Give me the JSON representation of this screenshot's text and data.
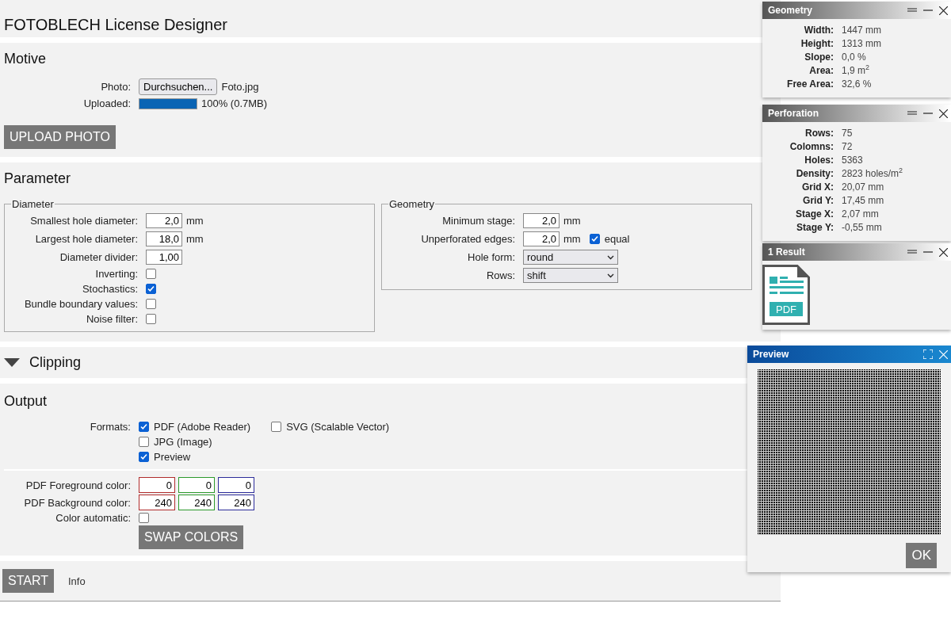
{
  "app": {
    "title": "FOTOBLECH License Designer"
  },
  "motive": {
    "heading": "Motive",
    "photo_label": "Photo:",
    "browse_button": "Durchsuchen...",
    "file_name": "Foto.jpg",
    "uploaded_label": "Uploaded:",
    "upload_progress": {
      "level": 1,
      "reading": "100% (0.7MB)"
    },
    "upload_button": "UPLOAD PHOTO"
  },
  "parameter": {
    "heading": "Parameter",
    "groups": [
      {
        "legend": "Diameter",
        "rows": [
          {
            "kind": "number",
            "label": "Smallest hole diameter:",
            "value": "2,0",
            "unit": "mm"
          },
          {
            "kind": "number",
            "label": "Largest hole diameter:",
            "value": "18,0",
            "unit": "mm"
          },
          {
            "kind": "number",
            "label": "Diameter divider:",
            "value": "1,00"
          },
          {
            "kind": "checkbox",
            "label": "Inverting:",
            "checked": false
          },
          {
            "kind": "checkbox",
            "label": "Stochastics:",
            "checked": true
          },
          {
            "kind": "checkbox",
            "label": "Bundle boundary values:",
            "checked": false
          },
          {
            "kind": "checkbox",
            "label": "Noise filter:",
            "checked": false
          }
        ]
      },
      {
        "legend": "Geometry",
        "rows": [
          {
            "kind": "number",
            "label": "Minimum stage:",
            "value": "2,0",
            "unit": "mm"
          },
          {
            "kind": "number",
            "label": "Unperforated edges:",
            "value": "2,0",
            "unit": "mm",
            "option": {
              "label": "equal",
              "checked": true
            }
          },
          {
            "kind": "select",
            "label": "Hole form:",
            "value": "round"
          },
          {
            "kind": "select",
            "label": "Rows:",
            "value": "shift"
          }
        ]
      }
    ]
  },
  "clipping": {
    "heading": "Clipping"
  },
  "output": {
    "heading": "Output",
    "formats_label": "Formats:",
    "format_columns": [
      [
        {
          "label": "PDF (Adobe Reader)",
          "checked": true
        },
        {
          "label": "JPG (Image)",
          "checked": false
        },
        {
          "label": "Preview",
          "checked": true
        }
      ],
      [
        {
          "label": "SVG (Scalable Vector)",
          "checked": false
        }
      ]
    ],
    "colors": [
      {
        "label": "PDF Foreground color:",
        "channels": [
          {
            "value": "0",
            "color": "#b02c2c"
          },
          {
            "value": "0",
            "color": "#2c9a2c"
          },
          {
            "value": "0",
            "color": "#2c2c9a"
          }
        ]
      },
      {
        "label": "PDF Background color:",
        "channels": [
          {
            "value": "240",
            "color": "#b02c2c"
          },
          {
            "value": "240",
            "color": "#2c9a2c"
          },
          {
            "value": "240",
            "color": "#2c2c9a"
          }
        ]
      }
    ],
    "color_auto": {
      "label": "Color automatic:",
      "checked": false
    },
    "swap_button": "SWAP COLORS"
  },
  "footer": {
    "start_button": "START",
    "info_link": "Info"
  },
  "panels": [
    {
      "title": "Geometry",
      "kind": "stats",
      "rows": [
        {
          "label": "Width:",
          "value": "1447 mm"
        },
        {
          "label": "Height:",
          "value": "1313 mm"
        },
        {
          "label": "Slope:",
          "value": "0,0 %"
        },
        {
          "label": "Area:",
          "value": "1,9 m$^{2}$"
        },
        {
          "label": "Free Area:",
          "value": "32,6 %"
        }
      ]
    },
    {
      "title": "Perforation",
      "kind": "stats",
      "rows": [
        {
          "label": "Rows:",
          "value": "75"
        },
        {
          "label": "Colomns:",
          "value": "72"
        },
        {
          "label": "Holes:",
          "value": "5363"
        },
        {
          "label": "Density:",
          "value": "2823 holes/m$^{2}$"
        },
        {
          "label": "Grid X:",
          "value": "20,07 mm"
        },
        {
          "label": "Grid Y:",
          "value": "17,45 mm"
        },
        {
          "label": "Stage X:",
          "value": "2,07 mm"
        },
        {
          "label": "Stage Y:",
          "value": "-0,55 mm"
        }
      ]
    },
    {
      "title": "1 Result",
      "kind": "files",
      "files": [
        {
          "label": "PDF"
        }
      ]
    }
  ],
  "preview": {
    "title": "Preview",
    "ok_button": "OK"
  }
}
